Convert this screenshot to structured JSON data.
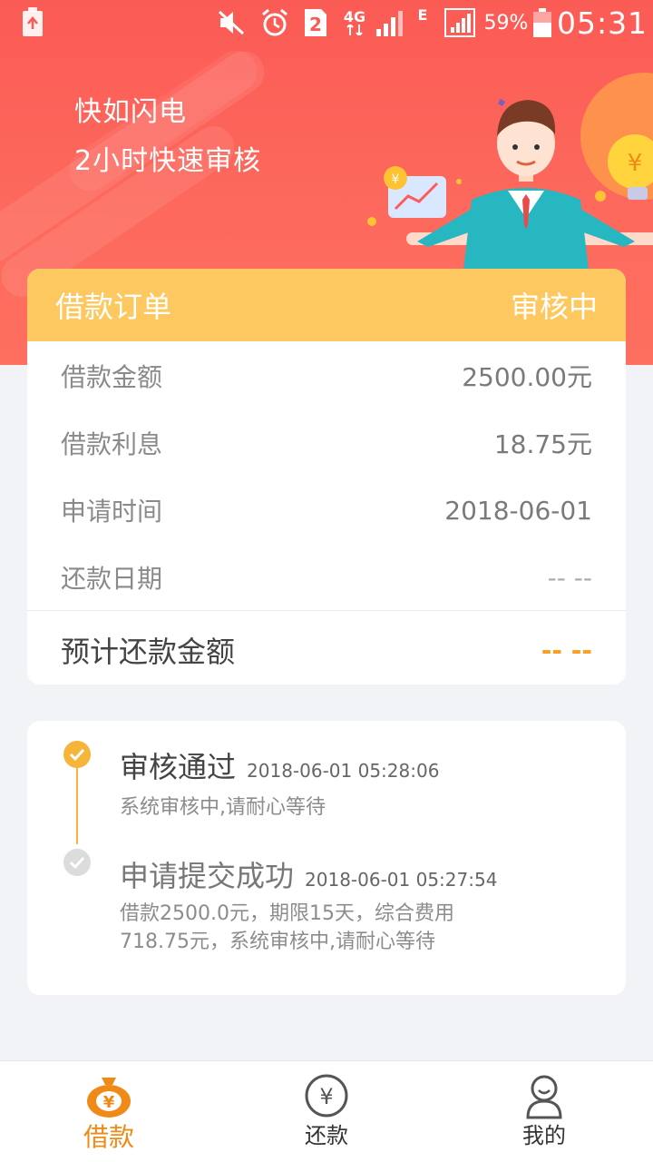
{
  "status_bar": {
    "battery_percent": "59%",
    "clock": "05:31",
    "sim_slot": "2",
    "network": "4G",
    "network2": "E"
  },
  "hero": {
    "line1": "快如闪电",
    "line2": "2小时快速审核"
  },
  "order": {
    "title": "借款订单",
    "status": "审核中",
    "rows": [
      {
        "label": "借款金额",
        "value": "2500.00元"
      },
      {
        "label": "借款利息",
        "value": "18.75元"
      },
      {
        "label": "申请时间",
        "value": "2018-06-01"
      },
      {
        "label": "还款日期",
        "value": "-- --"
      }
    ],
    "total_label": "预计还款金额",
    "total_value": "-- --"
  },
  "timeline": {
    "events": [
      {
        "title": "审核通过",
        "time": "2018-06-01 05:28:06",
        "desc": "系统审核中,请耐心等待",
        "active": true
      },
      {
        "title": "申请提交成功",
        "time": "2018-06-01 05:27:54",
        "desc": "借款2500.0元，期限15天，综合费用718.75元，系统审核中,请耐心等待",
        "active": false
      }
    ]
  },
  "nav": {
    "items": [
      {
        "label": "借款",
        "icon": "money-bag-icon",
        "active": true
      },
      {
        "label": "还款",
        "icon": "yen-circle-icon",
        "active": false
      },
      {
        "label": "我的",
        "icon": "user-icon",
        "active": false
      }
    ]
  },
  "colors": {
    "hero_red": "#fb5b55",
    "accent_yellow": "#fec861",
    "accent_orange": "#f08a17",
    "timeline_gold": "#f5b53b"
  }
}
